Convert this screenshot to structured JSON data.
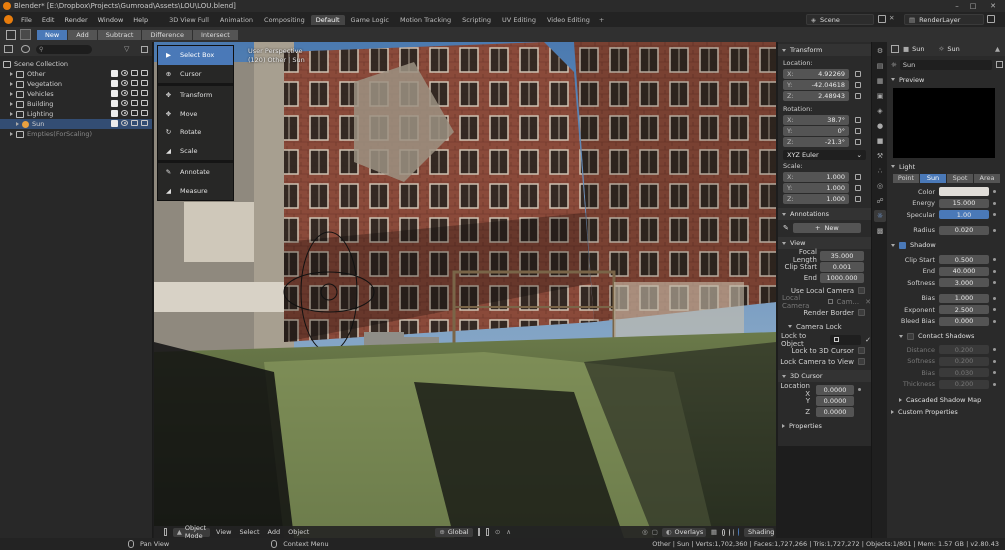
{
  "window": {
    "title": "Blender* [E:\\Dropbox\\Projects\\Gumroad\\Assets\\LOU\\LOU.blend]"
  },
  "menu": {
    "items": [
      "File",
      "Edit",
      "Render",
      "Window",
      "Help"
    ]
  },
  "workspaces": [
    "3D View Full",
    "Animation",
    "Compositing",
    "Default",
    "Game Logic",
    "Motion Tracking",
    "Scripting",
    "UV Editing",
    "Video Editing"
  ],
  "active_workspace": "Default",
  "scene": {
    "name": "Scene",
    "render_layer": "RenderLayer"
  },
  "tool_header": {
    "modes": [
      "New",
      "Add",
      "Subtract",
      "Difference",
      "Intersect"
    ]
  },
  "outliner": {
    "root": "Scene Collection",
    "items": [
      {
        "label": "Other",
        "indent": 1,
        "selected": false
      },
      {
        "label": "Vegetation",
        "indent": 1,
        "selected": false
      },
      {
        "label": "Vehicles",
        "indent": 1,
        "selected": false
      },
      {
        "label": "Building",
        "indent": 1,
        "selected": false
      },
      {
        "label": "Lighting",
        "indent": 1,
        "selected": false
      },
      {
        "label": "Sun",
        "indent": 2,
        "selected": true
      },
      {
        "label": "Empties(ForScaling)",
        "indent": 1,
        "selected": false
      }
    ]
  },
  "toolbar": {
    "tools": [
      {
        "label": "Select Box",
        "icon": "select-box-icon",
        "active": true
      },
      {
        "label": "Cursor",
        "icon": "cursor-icon",
        "active": false
      },
      {
        "label": "Transform",
        "icon": "transform-icon",
        "active": false
      },
      {
        "label": "Move",
        "icon": "move-icon",
        "active": false
      },
      {
        "label": "Rotate",
        "icon": "rotate-icon",
        "active": false
      },
      {
        "label": "Scale",
        "icon": "scale-icon",
        "active": false
      },
      {
        "label": "Annotate",
        "icon": "annotate-icon",
        "active": false
      },
      {
        "label": "Measure",
        "icon": "measure-icon",
        "active": false
      }
    ]
  },
  "viewport": {
    "info_line1": "User Perspective",
    "info_line2": "(120) Other | Sun",
    "mode": "Object Mode",
    "menus": [
      "View",
      "Select",
      "Add",
      "Object"
    ],
    "orientation": "Global",
    "overlays": "Overlays",
    "shading": "Shading"
  },
  "npanel": {
    "transform_header": "Transform",
    "location_label": "Location:",
    "location": [
      {
        "axis": "X:",
        "value": "4.92269"
      },
      {
        "axis": "Y:",
        "value": "-42.04618"
      },
      {
        "axis": "Z:",
        "value": "2.48943"
      }
    ],
    "rotation_label": "Rotation:",
    "rotation": [
      {
        "axis": "X:",
        "value": "38.7°"
      },
      {
        "axis": "Y:",
        "value": "0°"
      },
      {
        "axis": "Z:",
        "value": "-21.3°"
      }
    ],
    "rotation_mode": "XYZ Euler",
    "scale_label": "Scale:",
    "scale": [
      {
        "axis": "X:",
        "value": "1.000"
      },
      {
        "axis": "Y:",
        "value": "1.000"
      },
      {
        "axis": "Z:",
        "value": "1.000"
      }
    ],
    "annotations_header": "Annotations",
    "new_label": "New",
    "view_header": "View",
    "focal_length_label": "Focal Length",
    "focal_length": "35.000",
    "clip_start_label": "Clip Start",
    "clip_start": "0.001",
    "end_label": "End",
    "clip_end": "1000.000",
    "use_local_camera": "Use Local Camera",
    "local_camera_label": "Local Camera",
    "local_camera_value": "Cam...",
    "render_border": "Render Border",
    "camera_lock_header": "Camera Lock",
    "lock_to_object_label": "Lock to Object",
    "lock_to_3d_cursor": "Lock to 3D Cursor",
    "lock_camera_to_view": "Lock Camera to View",
    "cursor_header": "3D Cursor",
    "cursor_location_label": "Location X",
    "cursor_y_label": "Y",
    "cursor_z_label": "Z",
    "cursor": [
      "0.0000",
      "0.0000",
      "0.0000"
    ],
    "properties_header": "Properties"
  },
  "properties": {
    "object_name": "Sun",
    "data_name": "Sun",
    "light_name": "Sun",
    "preview_header": "Preview",
    "light_header": "Light",
    "light_types": [
      "Point",
      "Sun",
      "Spot",
      "Area"
    ],
    "active_light_type": "Sun",
    "color_label": "Color",
    "energy_label": "Energy",
    "energy": "15.000",
    "specular_label": "Specular",
    "specular": "1.00",
    "radius_label": "Radius",
    "radius": "0.020",
    "shadow_header": "Shadow",
    "clip_start_label": "Clip Start",
    "clip_start": "0.500",
    "end_label": "End",
    "end": "40.000",
    "softness_label": "Softness",
    "softness": "3.000",
    "bias_label": "Bias",
    "bias": "1.000",
    "exponent_label": "Exponent",
    "exponent": "2.500",
    "bleed_bias_label": "Bleed Bias",
    "bleed_bias": "0.000",
    "contact_shadows_header": "Contact Shadows",
    "distance_label": "Distance",
    "distance": "0.200",
    "cs_softness_label": "Softness",
    "cs_softness": "0.200",
    "cs_bias_label": "Bias",
    "cs_bias": "0.030",
    "thickness_label": "Thickness",
    "thickness": "0.200",
    "cascaded_header": "Cascaded Shadow Map",
    "custom_header": "Custom Properties"
  },
  "statusbar": {
    "pan_view": "Pan View",
    "context_menu": "Context Menu",
    "stats": "Other | Sun | Verts:1,702,360 | Faces:1,727,266 | Tris:1,727,272 | Objects:1/801 | Mem: 1.57 GB | v2.80.43"
  },
  "colors": {
    "accent": "#4a79b8",
    "selection": "#334d73",
    "panel": "#2a2a2a"
  }
}
